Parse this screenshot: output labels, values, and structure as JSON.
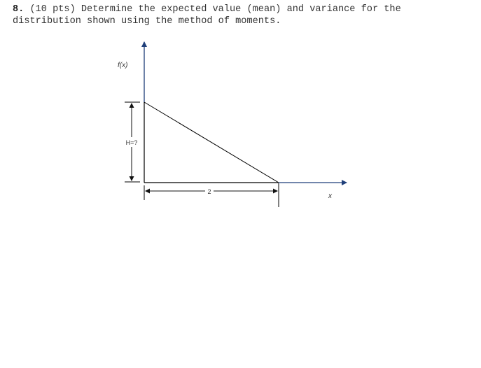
{
  "problem": {
    "number": "8.",
    "text_line1": " (10 pts) Determine the expected value (mean) and variance for the",
    "text_line2": "distribution shown using the method of moments."
  },
  "figure": {
    "y_axis_label": "f(x)",
    "x_axis_label": "x",
    "height_label": "H=?",
    "width_label": "2",
    "shape": "right triangle, decreasing linearly from H at x=0 to 0 at x=2",
    "colors": {
      "axis": "#1f3f7a",
      "lines": "#000000",
      "dimension": "#444444",
      "label_accent": "#c8742a"
    }
  }
}
